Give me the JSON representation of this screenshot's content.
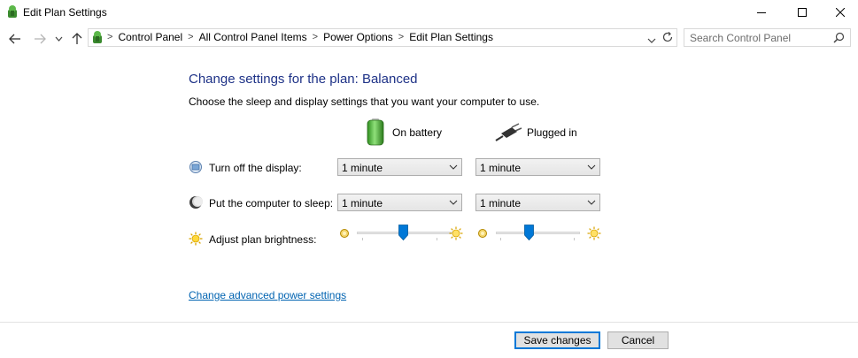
{
  "window": {
    "title": "Edit Plan Settings"
  },
  "address": {
    "breadcrumbs": [
      "Control Panel",
      "All Control Panel Items",
      "Power Options",
      "Edit Plan Settings"
    ]
  },
  "search": {
    "placeholder": "Search Control Panel"
  },
  "content": {
    "heading": "Change settings for the plan: Balanced",
    "subtext": "Choose the sleep and display settings that you want your computer to use.",
    "columns": {
      "battery": "On battery",
      "plugged": "Plugged in"
    },
    "rows": {
      "display": {
        "label": "Turn off the display:",
        "battery": "1 minute",
        "plugged": "1 minute"
      },
      "sleep": {
        "label": "Put the computer to sleep:",
        "battery": "1 minute",
        "plugged": "1 minute"
      },
      "brightness": {
        "label": "Adjust plan brightness:",
        "battery_level": 0.45,
        "plugged_level": 0.38
      }
    },
    "advanced_link": "Change advanced power settings"
  },
  "footer": {
    "save": "Save changes",
    "cancel": "Cancel"
  },
  "colors": {
    "heading": "#1e3287",
    "link": "#0063b1",
    "slider_thumb": "#0078d7"
  },
  "icons": [
    "app-power-icon",
    "back-arrow-icon",
    "forward-arrow-icon",
    "recent-dropdown-icon",
    "up-arrow-icon",
    "refresh-icon",
    "search-icon",
    "battery-icon",
    "plug-icon",
    "display-icon",
    "sleep-moon-icon",
    "brightness-sun-icon"
  ]
}
